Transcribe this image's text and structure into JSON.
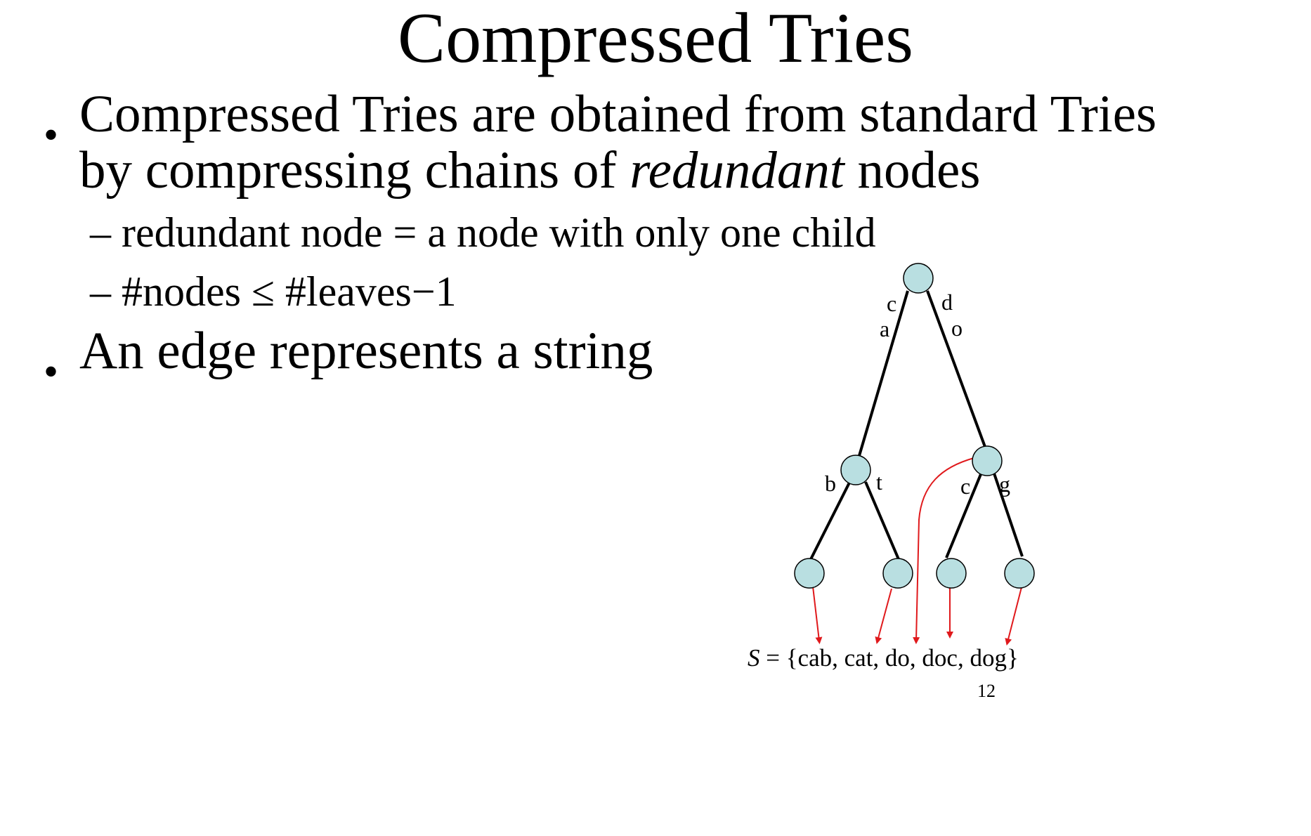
{
  "slide": {
    "title": "Compressed Tries",
    "bullets": [
      {
        "line1": "Compressed Tries are obtained from standard Tries",
        "line2_pre": "by compressing chains of ",
        "line2_em": "redundant",
        "line2_post": " nodes"
      },
      {
        "line1": "An edge represents a string"
      }
    ],
    "subbullets": [
      "– redundant node = a node with only one child",
      "– #nodes ≤ #leaves−1"
    ],
    "page_number": "12"
  },
  "diagram": {
    "node_color": "#b9dfe1",
    "edge_color": "#000000",
    "arrow_color": "#e0191c",
    "edge_labels": {
      "root_left_1": "c",
      "root_left_2": "a",
      "root_right_1": "d",
      "root_right_2": "o",
      "left_left": "b",
      "left_right": "t",
      "right_left": "c",
      "right_right": "g"
    },
    "set": {
      "var": "S",
      "eq": " = ",
      "body": "{cab, cat, do, doc, dog}"
    }
  }
}
